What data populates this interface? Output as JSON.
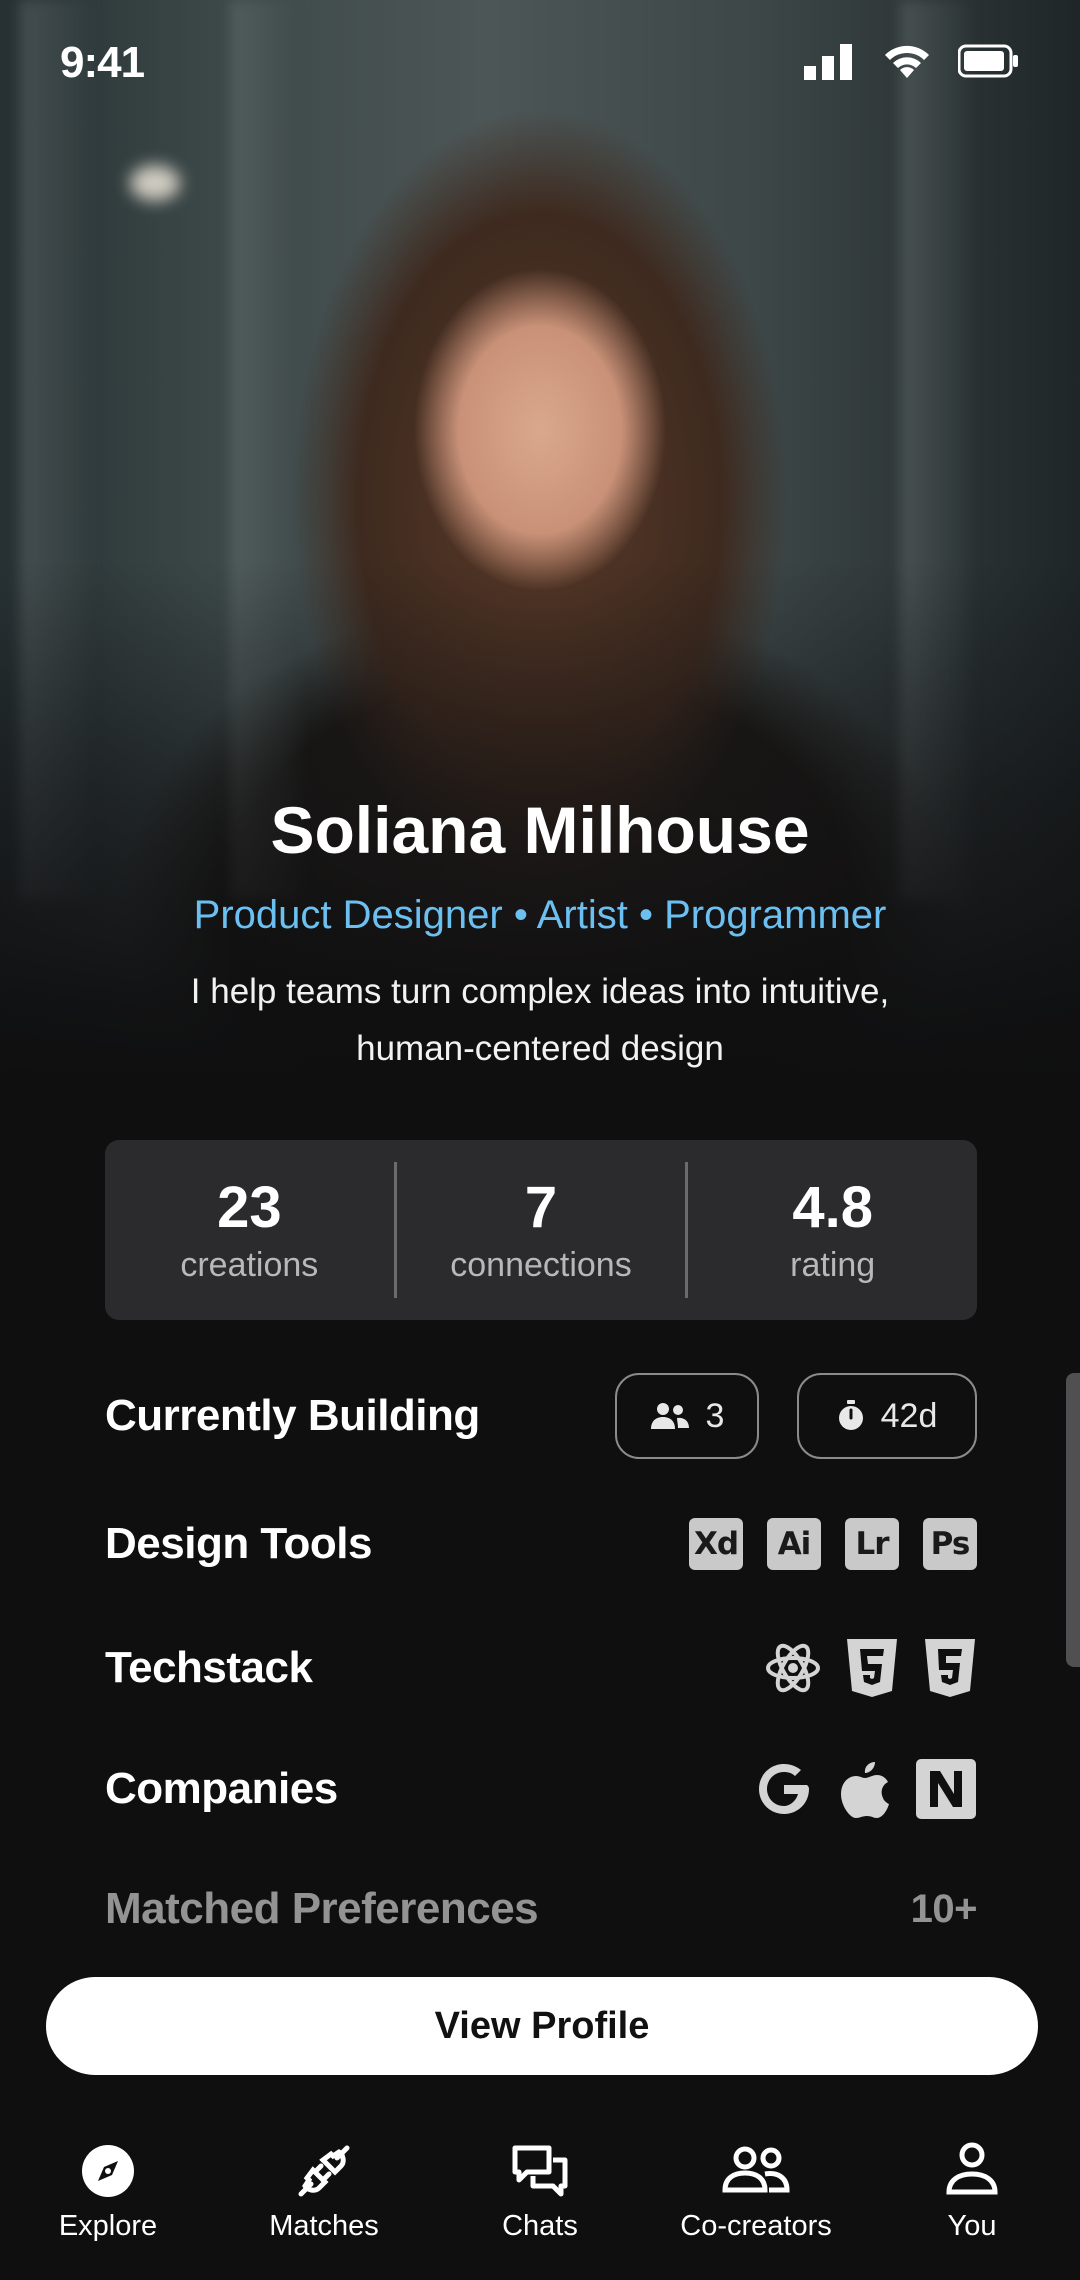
{
  "status_bar": {
    "time": "9:41"
  },
  "profile": {
    "name": "Soliana Milhouse",
    "roles": "Product Designer • Artist • Programmer",
    "bio": "I help teams turn complex ideas into intuitive, human-centered design"
  },
  "stats": [
    {
      "value": "23",
      "label": "creations"
    },
    {
      "value": "7",
      "label": "connections"
    },
    {
      "value": "4.8",
      "label": "rating"
    }
  ],
  "currently_building": {
    "title": "Currently Building",
    "members": "3",
    "days": "42d"
  },
  "design_tools": {
    "title": "Design Tools",
    "items": [
      "Xd",
      "Ai",
      "Lr",
      "Ps"
    ]
  },
  "techstack": {
    "title": "Techstack",
    "icons": [
      "react-icon",
      "html5-icon",
      "css3-icon"
    ]
  },
  "companies": {
    "title": "Companies",
    "icons": [
      "google-icon",
      "apple-icon",
      "notion-icon"
    ]
  },
  "matched_preferences": {
    "title": "Matched Preferences",
    "count": "10+"
  },
  "cta": {
    "label": "View Profile"
  },
  "nav": [
    {
      "label": "Explore",
      "icon": "compass-icon"
    },
    {
      "label": "Matches",
      "icon": "plug-icon"
    },
    {
      "label": "Chats",
      "icon": "chat-icon"
    },
    {
      "label": "Co-creators",
      "icon": "group-icon"
    },
    {
      "label": "You",
      "icon": "user-icon"
    }
  ],
  "colors": {
    "accent": "#6cc0f1",
    "background": "#0f0f10",
    "card": "#2b2b2d"
  }
}
